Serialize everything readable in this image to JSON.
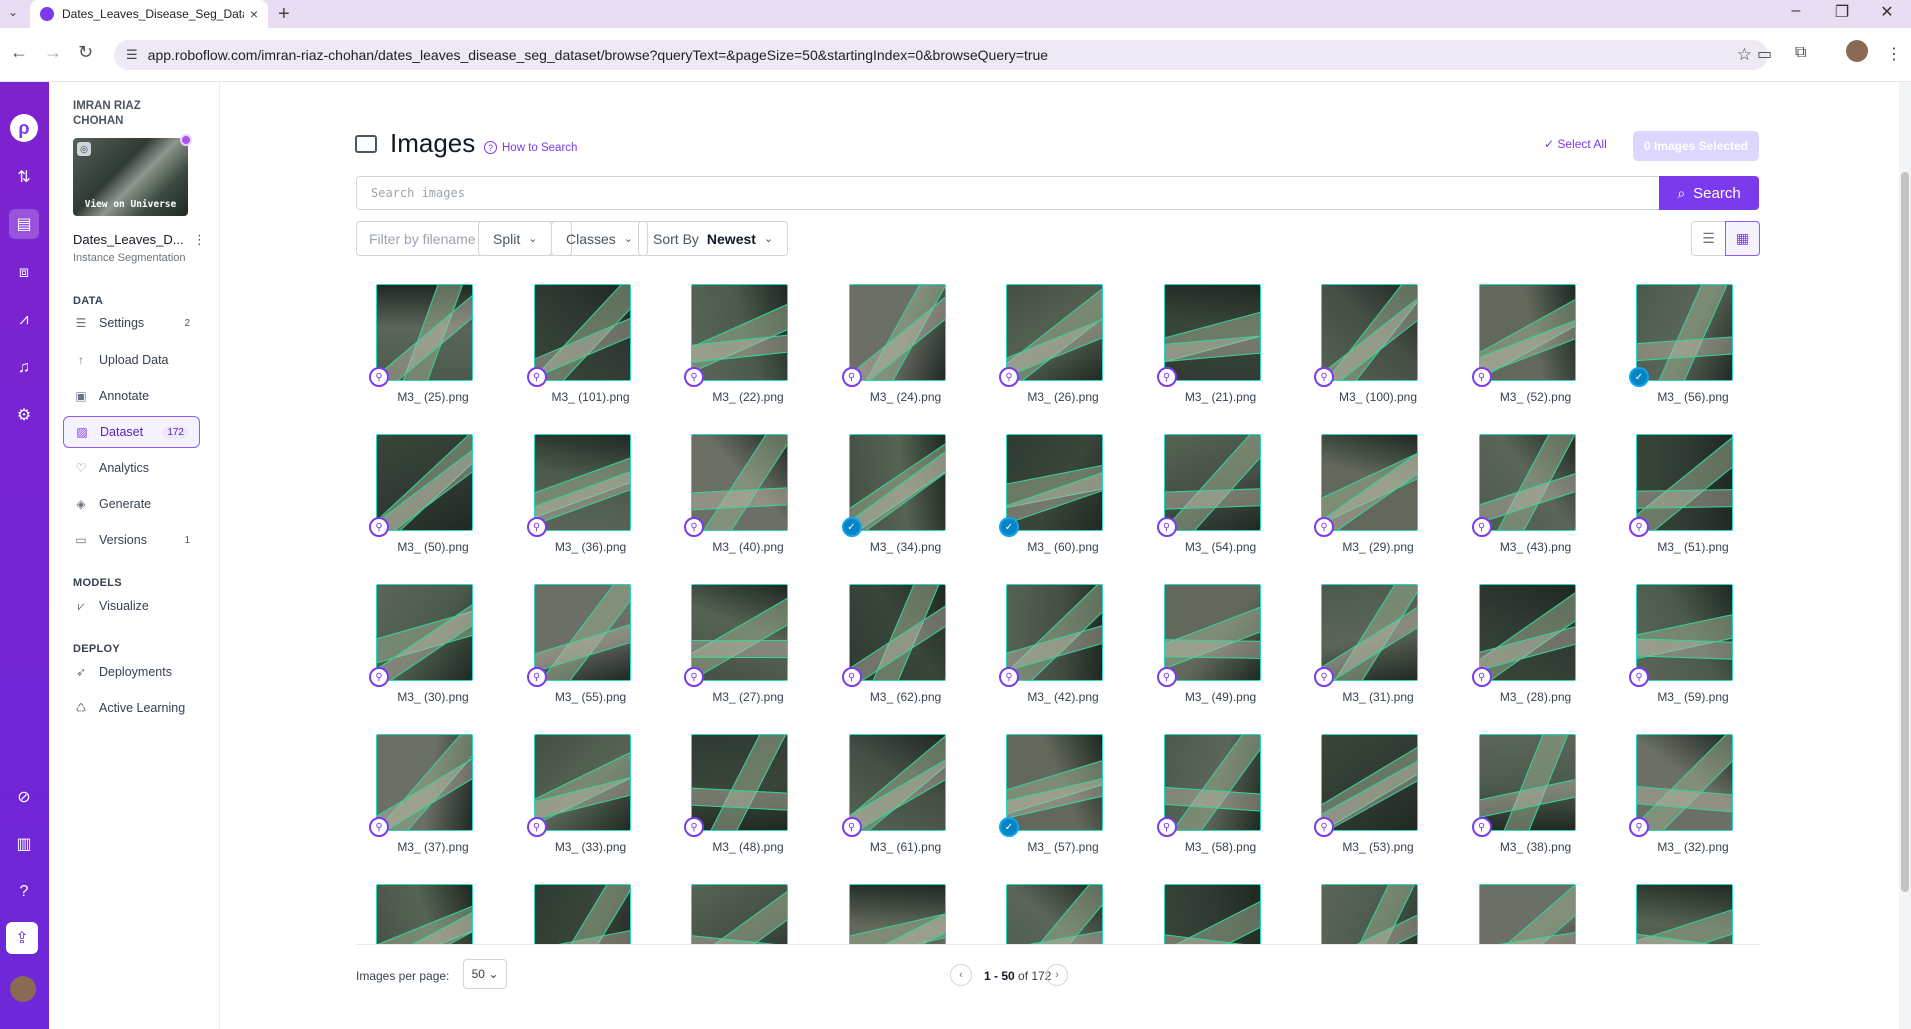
{
  "browser": {
    "tab_title": "Dates_Leaves_Disease_Seg_Data",
    "url": "app.roboflow.com/imran-riaz-chohan/dates_leaves_disease_seg_dataset/browse?queryText=&pageSize=50&startingIndex=0&browseQuery=true"
  },
  "sidebar": {
    "owner": "IMRAN RIAZ CHOHAN",
    "thumb_caption": "View on Universe",
    "project_name": "Dates_Leaves_D...",
    "project_type": "Instance Segmentation",
    "sections": {
      "data": "DATA",
      "models": "MODELS",
      "deploy": "DEPLOY"
    },
    "items": [
      {
        "label": "Settings",
        "badge": "2"
      },
      {
        "label": "Upload Data",
        "badge": ""
      },
      {
        "label": "Annotate",
        "badge": ""
      },
      {
        "label": "Dataset",
        "badge": "172"
      },
      {
        "label": "Analytics",
        "badge": ""
      },
      {
        "label": "Generate",
        "badge": ""
      },
      {
        "label": "Versions",
        "badge": "1"
      },
      {
        "label": "Visualize",
        "badge": ""
      },
      {
        "label": "Deployments",
        "badge": ""
      },
      {
        "label": "Active Learning",
        "badge": ""
      }
    ]
  },
  "header": {
    "title": "Images",
    "how_to_search": "How to Search",
    "select_all": "Select All",
    "selected_count": "0 Images Selected"
  },
  "search": {
    "placeholder": "Search images",
    "button": "Search"
  },
  "filters": {
    "filename_placeholder": "Filter by filename",
    "split": "Split",
    "classes": "Classes",
    "sort_by": "Sort By",
    "sort_value": "Newest"
  },
  "images": [
    {
      "name": "M3_ (25).png",
      "status": "annotated"
    },
    {
      "name": "M3_ (101).png",
      "status": "annotated"
    },
    {
      "name": "M3_ (22).png",
      "status": "annotated"
    },
    {
      "name": "M3_ (24).png",
      "status": "annotated"
    },
    {
      "name": "M3_ (26).png",
      "status": "annotated"
    },
    {
      "name": "M3_ (21).png",
      "status": "annotated"
    },
    {
      "name": "M3_ (100).png",
      "status": "annotated"
    },
    {
      "name": "M3_ (52).png",
      "status": "annotated"
    },
    {
      "name": "M3_ (56).png",
      "status": "approved"
    },
    {
      "name": "M3_ (50).png",
      "status": "annotated"
    },
    {
      "name": "M3_ (36).png",
      "status": "annotated"
    },
    {
      "name": "M3_ (40).png",
      "status": "annotated"
    },
    {
      "name": "M3_ (34).png",
      "status": "approved"
    },
    {
      "name": "M3_ (60).png",
      "status": "approved"
    },
    {
      "name": "M3_ (54).png",
      "status": "annotated"
    },
    {
      "name": "M3_ (29).png",
      "status": "annotated"
    },
    {
      "name": "M3_ (43).png",
      "status": "annotated"
    },
    {
      "name": "M3_ (51).png",
      "status": "annotated"
    },
    {
      "name": "M3_ (30).png",
      "status": "annotated"
    },
    {
      "name": "M3_ (55).png",
      "status": "annotated"
    },
    {
      "name": "M3_ (27).png",
      "status": "annotated"
    },
    {
      "name": "M3_ (62).png",
      "status": "annotated"
    },
    {
      "name": "M3_ (42).png",
      "status": "annotated"
    },
    {
      "name": "M3_ (49).png",
      "status": "annotated"
    },
    {
      "name": "M3_ (31).png",
      "status": "annotated"
    },
    {
      "name": "M3_ (28).png",
      "status": "annotated"
    },
    {
      "name": "M3_ (59).png",
      "status": "annotated"
    },
    {
      "name": "M3_ (37).png",
      "status": "annotated"
    },
    {
      "name": "M3_ (33).png",
      "status": "annotated"
    },
    {
      "name": "M3_ (48).png",
      "status": "annotated"
    },
    {
      "name": "M3_ (61).png",
      "status": "annotated"
    },
    {
      "name": "M3_ (57).png",
      "status": "approved"
    },
    {
      "name": "M3_ (58).png",
      "status": "annotated"
    },
    {
      "name": "M3_ (53).png",
      "status": "annotated"
    },
    {
      "name": "M3_ (38).png",
      "status": "annotated"
    },
    {
      "name": "M3_ (32).png",
      "status": "annotated"
    },
    {
      "name": "",
      "status": ""
    },
    {
      "name": "",
      "status": ""
    },
    {
      "name": "",
      "status": ""
    },
    {
      "name": "",
      "status": ""
    },
    {
      "name": "",
      "status": ""
    },
    {
      "name": "",
      "status": ""
    },
    {
      "name": "",
      "status": ""
    },
    {
      "name": "",
      "status": ""
    },
    {
      "name": "",
      "status": ""
    }
  ],
  "pager": {
    "per_page_label": "Images per page:",
    "per_page": "50",
    "range": "1 - 50",
    "of": "of 172"
  },
  "colors": {
    "accent": "#7c3aed",
    "annotation": "#2dd4bf",
    "approved": "#0284c7"
  }
}
